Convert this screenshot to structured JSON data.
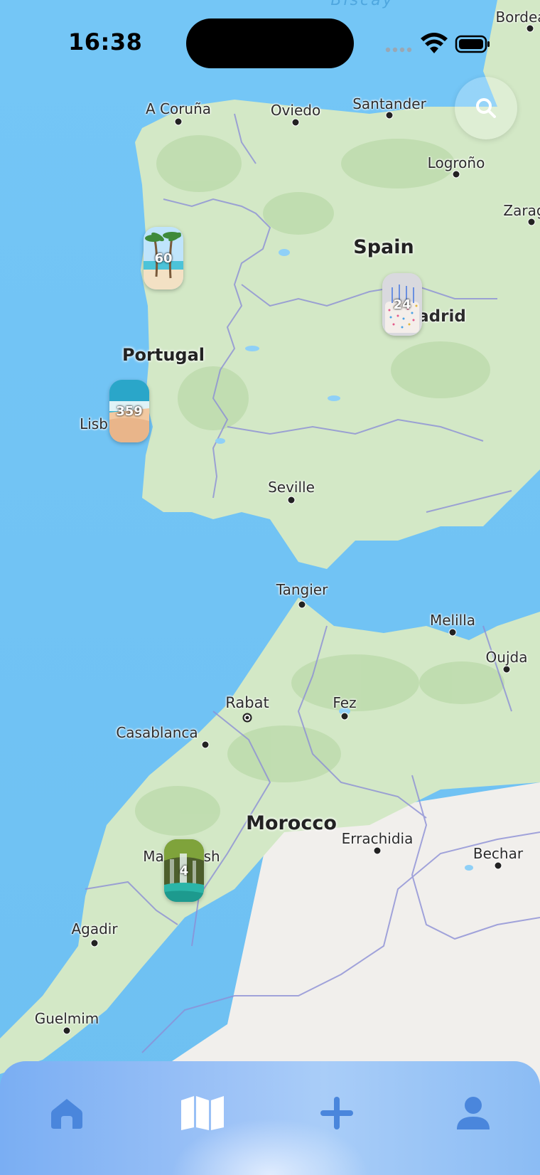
{
  "status_bar": {
    "time": "16:38"
  },
  "map": {
    "sea_labels": [
      {
        "name": "Biscay"
      }
    ],
    "country_labels": [
      {
        "id": "spain",
        "name": "Spain"
      },
      {
        "id": "portugal",
        "name": "Portugal"
      },
      {
        "id": "morocco",
        "name": "Morocco"
      }
    ],
    "cities": [
      {
        "id": "bordeaux",
        "name": "Bordea"
      },
      {
        "id": "a-coruna",
        "name": "A Coruña"
      },
      {
        "id": "oviedo",
        "name": "Oviedo"
      },
      {
        "id": "santander",
        "name": "Santander"
      },
      {
        "id": "logrono",
        "name": "Logroño"
      },
      {
        "id": "zaragoza",
        "name": "Zarag"
      },
      {
        "id": "madrid",
        "name": "adrid"
      },
      {
        "id": "lisbon",
        "name": "Lisb"
      },
      {
        "id": "seville",
        "name": "Seville"
      },
      {
        "id": "tangier",
        "name": "Tangier"
      },
      {
        "id": "melilla",
        "name": "Melilla"
      },
      {
        "id": "oujda",
        "name": "Oujda"
      },
      {
        "id": "rabat",
        "name": "Rabat"
      },
      {
        "id": "fez",
        "name": "Fez"
      },
      {
        "id": "casablanca",
        "name": "Casablanca"
      },
      {
        "id": "errachidia",
        "name": "Errachidia"
      },
      {
        "id": "bechar",
        "name": "Bechar"
      },
      {
        "id": "marrakesh",
        "name": "Ma"
      },
      {
        "id": "marrakesh-tail",
        "name": "esh"
      },
      {
        "id": "agadir",
        "name": "Agadir"
      },
      {
        "id": "guelmim",
        "name": "Guelmim"
      }
    ],
    "photo_markers": [
      {
        "id": "porto",
        "count": "60",
        "theme": "palm-beach"
      },
      {
        "id": "madrid",
        "count": "24",
        "theme": "birthday-cake"
      },
      {
        "id": "lisbon",
        "count": "359",
        "theme": "beach"
      },
      {
        "id": "marrakesh",
        "count": "4",
        "theme": "waterfall"
      }
    ]
  },
  "search": {
    "icon": "search-icon"
  },
  "tab_bar": {
    "tabs": [
      {
        "id": "home",
        "icon": "home-icon",
        "active": false
      },
      {
        "id": "map",
        "icon": "map-icon",
        "active": true
      },
      {
        "id": "add",
        "icon": "plus-icon",
        "active": false
      },
      {
        "id": "profile",
        "icon": "person-icon",
        "active": false
      }
    ],
    "colors": {
      "active": "#ffffff",
      "inactive": "#4a86dc"
    }
  }
}
